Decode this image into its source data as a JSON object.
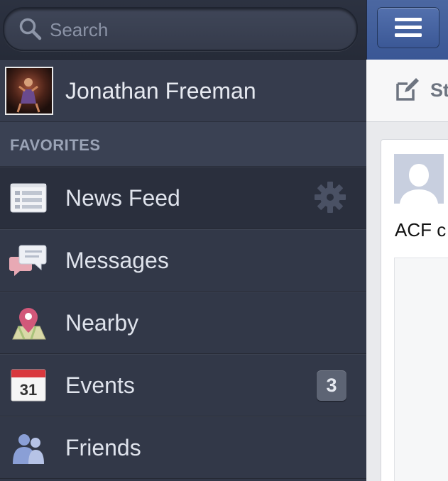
{
  "search": {
    "placeholder": "Search"
  },
  "profile": {
    "name": "Jonathan Freeman"
  },
  "favorites": {
    "header": "FAVORITES",
    "items": [
      {
        "label": "News Feed",
        "icon": "news-feed-icon",
        "selected": true
      },
      {
        "label": "Messages",
        "icon": "messages-icon"
      },
      {
        "label": "Nearby",
        "icon": "nearby-pin-icon"
      },
      {
        "label": "Events",
        "icon": "calendar-icon",
        "calendar_day": "31",
        "badge": "3"
      },
      {
        "label": "Friends",
        "icon": "friends-icon"
      }
    ]
  },
  "feed": {
    "status_label": "St",
    "post_text": "ACF c"
  },
  "colors": {
    "sidebar_bg": "#323848",
    "header_blue": "#3b5998",
    "badge_bg": "#5d6474",
    "feed_bg": "#e9eaed"
  }
}
